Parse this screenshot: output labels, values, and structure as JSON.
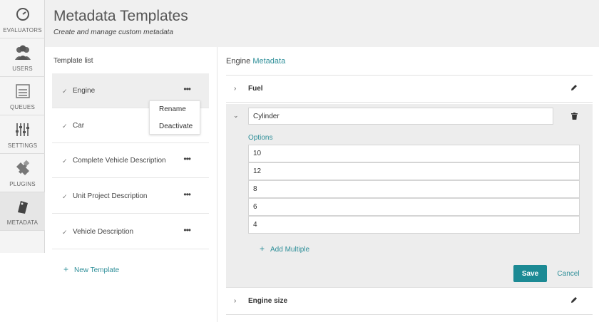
{
  "sidebar": {
    "items": [
      {
        "label": "EVALUATORS",
        "icon": "gauge-icon"
      },
      {
        "label": "USERS",
        "icon": "users-icon"
      },
      {
        "label": "QUEUES",
        "icon": "queue-list-icon"
      },
      {
        "label": "SETTINGS",
        "icon": "sliders-icon"
      },
      {
        "label": "PLUGINS",
        "icon": "puzzle-icon"
      },
      {
        "label": "METADATA",
        "icon": "tag-icon"
      }
    ],
    "active": "METADATA"
  },
  "header": {
    "title": "Metadata Templates",
    "subtitle": "Create and manage custom metadata"
  },
  "template_list": {
    "heading": "Template list",
    "items": [
      {
        "name": "Engine",
        "selected": true
      },
      {
        "name": "Car",
        "selected": false
      },
      {
        "name": "Complete Vehicle Description",
        "selected": false
      },
      {
        "name": "Unit Project Description",
        "selected": false
      },
      {
        "name": "Vehicle Description",
        "selected": false
      }
    ],
    "more_glyph": "•••",
    "check_glyph": "✓",
    "new_template_label": "New Template"
  },
  "context_menu": {
    "items": [
      "Rename",
      "Deactivate"
    ]
  },
  "detail": {
    "title_prefix": "Engine",
    "title_suffix": "Metadata",
    "fields": [
      {
        "name": "Fuel",
        "expanded": false
      },
      {
        "name": "Cylinder",
        "expanded": true
      },
      {
        "name": "Engine size",
        "expanded": false
      }
    ],
    "expanded_field": {
      "name_value": "Cylinder",
      "options_label": "Options",
      "options": [
        "10",
        "12",
        "8",
        "6",
        "4"
      ],
      "add_multiple_label": "Add Multiple",
      "save_label": "Save",
      "cancel_label": "Cancel"
    }
  },
  "colors": {
    "accent": "#2f8f99",
    "primary_button": "#1c8a94"
  }
}
